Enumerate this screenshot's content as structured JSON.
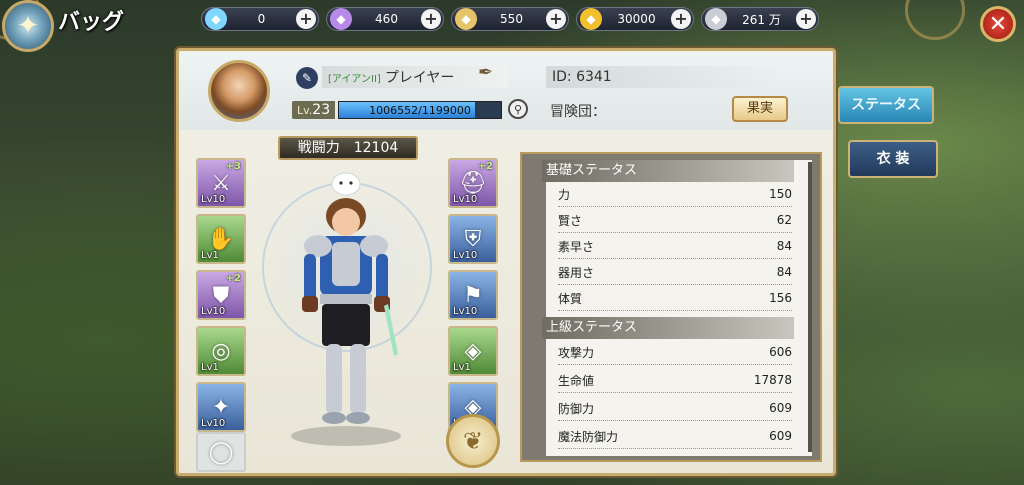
{
  "header": {
    "title": "バッグ"
  },
  "currencies": [
    {
      "icon": "blue-crystal-icon",
      "value": "0",
      "color": "#7fd6ff"
    },
    {
      "icon": "purple-crystal-icon",
      "value": "460",
      "color": "#b88ae8"
    },
    {
      "icon": "bag-icon",
      "value": "550",
      "color": "#e6c46a"
    },
    {
      "icon": "gold-coin-icon",
      "value": "30000",
      "color": "#f2c02e"
    },
    {
      "icon": "silver-coin-icon",
      "value": "261 万",
      "color": "#c9ced6"
    }
  ],
  "profile": {
    "title_tag": "[アイアンII]",
    "name": "プレイヤー",
    "id": "ID: 6341",
    "level_prefix": "Lv.",
    "level": "23",
    "xp_text": "1006552/1199000",
    "xp_fraction": 0.8395,
    "guild_label": "冒険団：",
    "fruit_button": "果実"
  },
  "tabs": {
    "status": "ステータス",
    "costume": "衣 装"
  },
  "power": {
    "label": "戦闘力　12104"
  },
  "equipment_left": [
    {
      "name": "sword",
      "icon": "sword-icon",
      "glyph": "⚔",
      "rarity": "purple",
      "level": "Lv10",
      "plus": "+3"
    },
    {
      "name": "gauntlet",
      "icon": "gauntlet-icon",
      "glyph": "✋",
      "rarity": "green",
      "level": "Lv1",
      "plus": ""
    },
    {
      "name": "greaves",
      "icon": "greaves-icon",
      "glyph": "⛊",
      "rarity": "purple",
      "level": "Lv10",
      "plus": "+2"
    },
    {
      "name": "bracer",
      "icon": "bracer-icon",
      "glyph": "◎",
      "rarity": "green",
      "level": "Lv1",
      "plus": ""
    },
    {
      "name": "amulet",
      "icon": "amulet-icon",
      "glyph": "✦",
      "rarity": "blue",
      "level": "Lv10",
      "plus": ""
    },
    {
      "name": "empty",
      "icon": "empty-slot-icon",
      "glyph": "◯",
      "rarity": "empty",
      "level": "",
      "plus": ""
    }
  ],
  "equipment_right": [
    {
      "name": "helmet",
      "icon": "helmet-icon",
      "glyph": "⛑",
      "rarity": "purple",
      "level": "Lv10",
      "plus": "+2"
    },
    {
      "name": "chest",
      "icon": "chest-armor-icon",
      "glyph": "⛨",
      "rarity": "blue",
      "level": "Lv10",
      "plus": ""
    },
    {
      "name": "boots",
      "icon": "boots-icon",
      "glyph": "⚑",
      "rarity": "blue",
      "level": "Lv10",
      "plus": ""
    },
    {
      "name": "ring",
      "icon": "ring-icon",
      "glyph": "◈",
      "rarity": "green",
      "level": "Lv1",
      "plus": ""
    },
    {
      "name": "ring2",
      "icon": "ring-icon",
      "glyph": "◈",
      "rarity": "blue",
      "level": "Lv10",
      "plus": ""
    }
  ],
  "stats": {
    "basic_title": "基礎ステータス",
    "basic": [
      {
        "label": "力",
        "value": "150"
      },
      {
        "label": "賢さ",
        "value": "62"
      },
      {
        "label": "素早さ",
        "value": "84"
      },
      {
        "label": "器用さ",
        "value": "84"
      },
      {
        "label": "体質",
        "value": "156"
      }
    ],
    "advanced_title": "上級ステータス",
    "advanced": [
      {
        "label": "攻撃力",
        "value": "606"
      },
      {
        "label": "生命値",
        "value": "17878"
      },
      {
        "label": "防御力",
        "value": "609"
      },
      {
        "label": "魔法防御力",
        "value": "609"
      }
    ]
  }
}
